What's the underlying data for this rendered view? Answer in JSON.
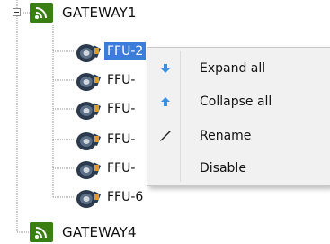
{
  "tree": {
    "gateways": [
      {
        "label": "GATEWAY1",
        "expanded": true
      },
      {
        "label": "GATEWAY4",
        "expanded": false
      }
    ],
    "children": [
      {
        "label": "FFU-2",
        "selected": true
      },
      {
        "label": "FFU-"
      },
      {
        "label": "FFU-"
      },
      {
        "label": "FFU-"
      },
      {
        "label": "FFU-"
      },
      {
        "label": "FFU-6"
      }
    ]
  },
  "context_menu": {
    "items": [
      {
        "label": "Expand all",
        "icon": "arrow-down-icon"
      },
      {
        "label": "Collapse all",
        "icon": "arrow-up-icon"
      },
      {
        "label": "Rename",
        "icon": "pencil-icon"
      },
      {
        "label": "Disable",
        "icon": ""
      }
    ]
  },
  "colors": {
    "selection": "#3b7dd8",
    "gateway_icon": "#3a7f14",
    "menu_background": "#f1f1f1",
    "menu_arrow_icon": "#3b8fe0"
  }
}
